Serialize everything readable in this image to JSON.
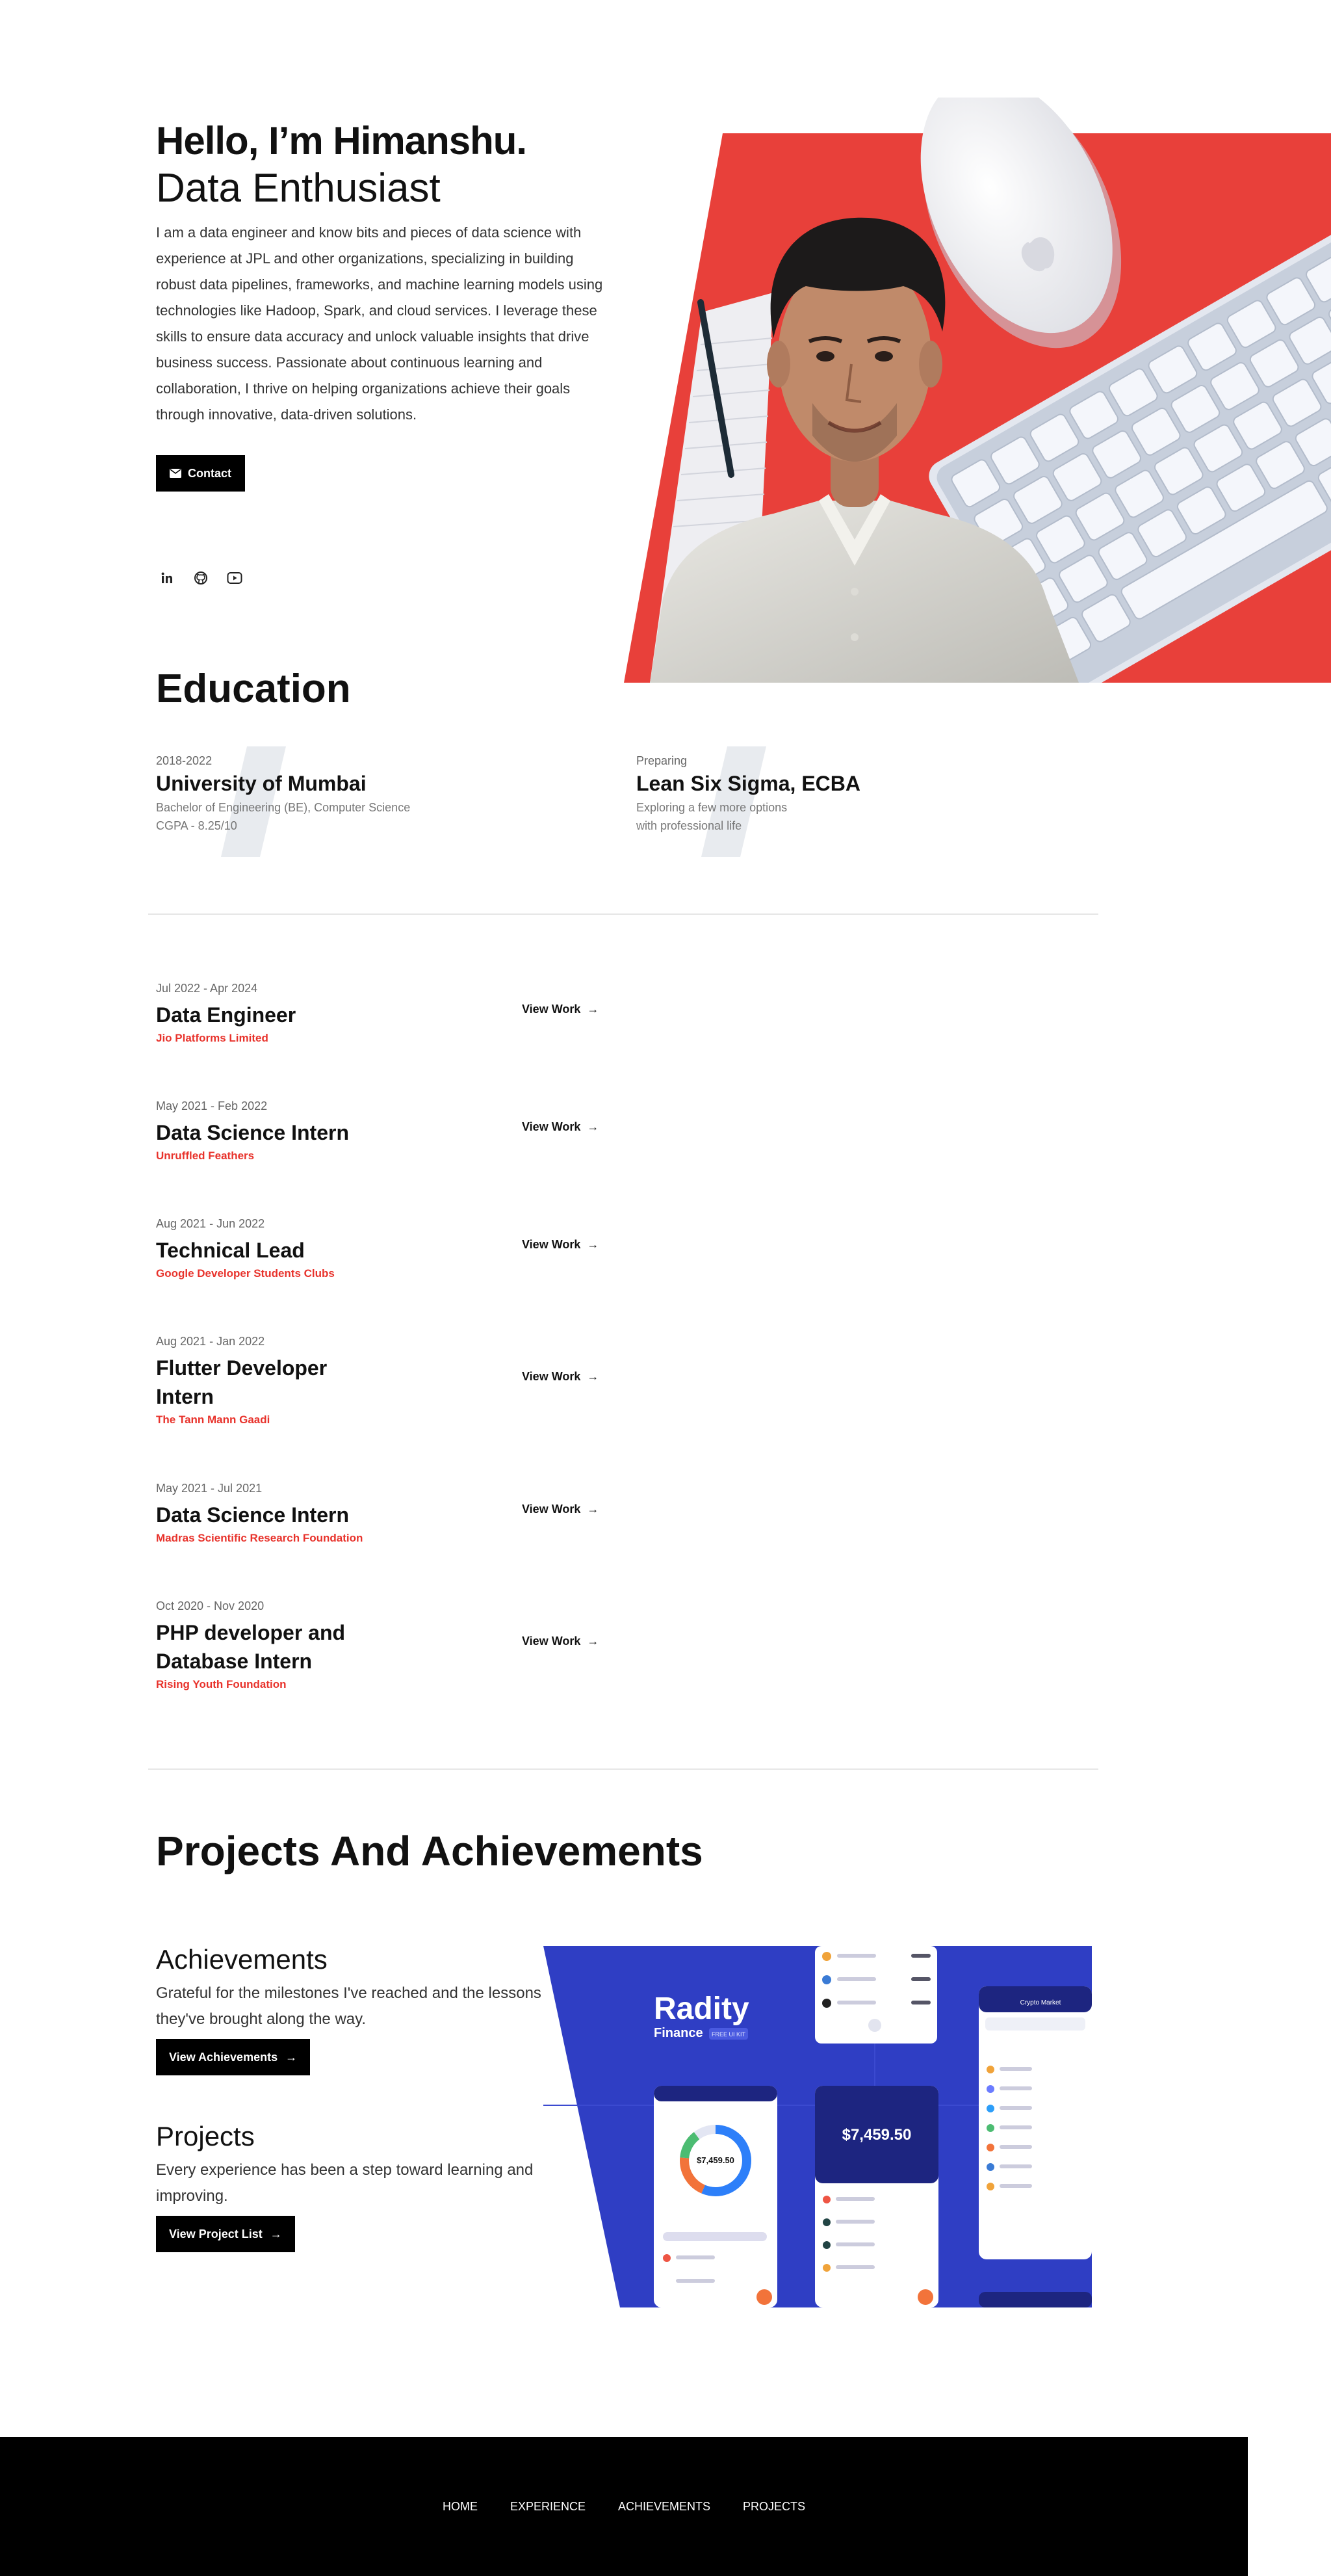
{
  "hero": {
    "greeting": "Hello, I’m Himanshu.",
    "role": "Data Enthusiast",
    "description": "I am a data engineer and know bits and pieces of data science with experience at JPL and other organizations, specializing in building robust data pipelines, frameworks, and machine learning models using technologies like Hadoop, Spark, and cloud services. I leverage these skills to ensure data accuracy and unlock valuable insights that drive business success. Passionate about continuous learning and collaboration, I thrive on helping organizations achieve their goals through innovative, data-driven solutions.",
    "contact_label": "Contact",
    "socials": [
      "linkedin-icon",
      "github-icon",
      "youtube-icon"
    ]
  },
  "education": {
    "title": "Education",
    "items": [
      {
        "date": "2018-2022",
        "name": "University of Mumbai",
        "line1": "Bachelor of Engineering (BE), Computer Science",
        "line2": "CGPA - 8.25/10"
      },
      {
        "date": "Preparing",
        "name": "Lean Six Sigma, ECBA",
        "line1": "Exploring a few more options",
        "line2": "with professional life"
      }
    ]
  },
  "experience": {
    "view_label": "View Work",
    "items": [
      {
        "date": "Jul 2022 - Apr 2024",
        "title": "Data Engineer",
        "company": "Jio Platforms Limited"
      },
      {
        "date": "May 2021 - Feb 2022",
        "title": "Data Science Intern",
        "company": "Unruffled Feathers"
      },
      {
        "date": "Aug 2021 - Jun 2022",
        "title": "Technical Lead",
        "company": "Google Developer Students Clubs"
      },
      {
        "date": "Aug 2021 - Jan 2022",
        "title": "Flutter Developer Intern",
        "company": "The Tann Mann Gaadi"
      },
      {
        "date": "May 2021 - Jul 2021",
        "title": "Data Science Intern",
        "company": "Madras Scientific Research Foundation"
      },
      {
        "date": "Oct 2020 - Nov 2020",
        "title": "PHP developer and Database Intern",
        "company": "Rising Youth Foundation"
      }
    ]
  },
  "projects": {
    "title": "Projects And Achievements",
    "achievements": {
      "heading": "Achievements",
      "text": "Grateful for the milestones I've reached and the lessons they've brought along the way.",
      "button": "View Achievements"
    },
    "projects": {
      "heading": "Projects",
      "text": "Every experience has been a step toward learning and improving.",
      "button": "View Project List"
    },
    "mockup": {
      "brand": "Radity",
      "brand_sub": "Finance",
      "brand_tag": "FREE UI KIT",
      "balance": "$7,459.50",
      "market_title": "Crypto Market"
    }
  },
  "footer": {
    "nav": [
      "HOME",
      "EXPERIENCE",
      "ACHIEVEMENTS",
      "PROJECTS"
    ]
  },
  "colors": {
    "accent": "#e8322b",
    "mockup_bg": "#2f3ec4",
    "footer_bg": "#000000"
  }
}
